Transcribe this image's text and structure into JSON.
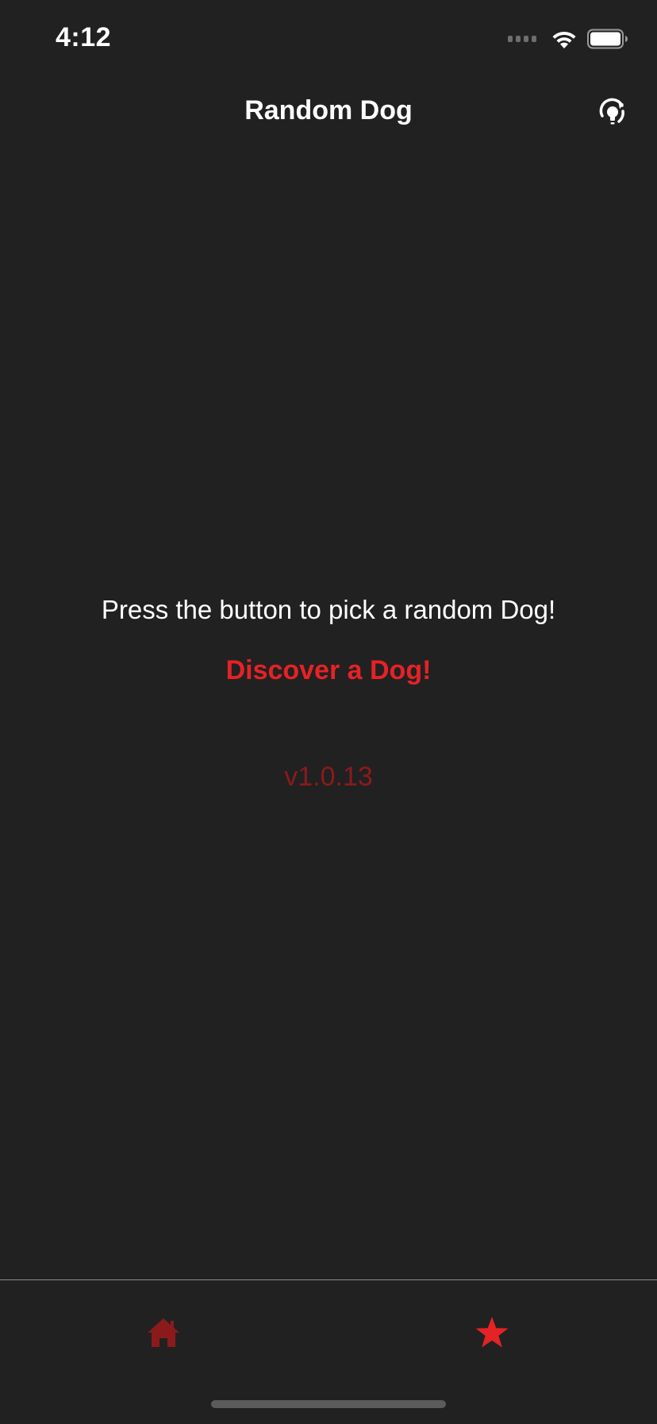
{
  "status_bar": {
    "time": "4:12",
    "icons": [
      "signal-dots-icon",
      "wifi-icon",
      "battery-icon"
    ]
  },
  "nav": {
    "title": "Random Dog",
    "action_icon": "refresh-lightbulb-icon"
  },
  "main": {
    "prompt": "Press the button to pick a random Dog!",
    "discover_label": "Discover a Dog!",
    "version": "v1.0.13"
  },
  "tab_bar": {
    "tabs": [
      {
        "icon": "home-icon",
        "selected": false
      },
      {
        "icon": "star-icon",
        "selected": true
      }
    ]
  },
  "colors": {
    "background": "#212121",
    "accent": "#e52226",
    "accent_muted": "#8b1a1c",
    "text": "#ffffff"
  }
}
